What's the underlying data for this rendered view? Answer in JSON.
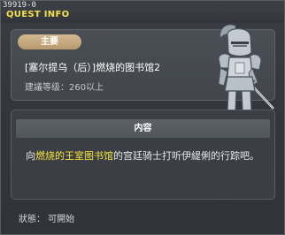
{
  "header": {
    "quest_id": "39919-0",
    "title": "QUEST INFO"
  },
  "summary": {
    "badge": "主要",
    "quest_name": "[塞尔提乌（后）]燃烧的图书馆2",
    "recommended_level": "建議等级：260以上",
    "npc_icon": "armored-knight-icon"
  },
  "content": {
    "header": "内容",
    "desc_before": "向",
    "desc_highlight": "燃烧的王室图书馆",
    "desc_after": "的宫廷骑士打听伊緹俐的行踪吧。"
  },
  "footer": {
    "status": "狀態：  可開始"
  },
  "colors": {
    "title": "#f2e04a",
    "highlight": "#f4e23c",
    "badge": "#c9ad83"
  }
}
